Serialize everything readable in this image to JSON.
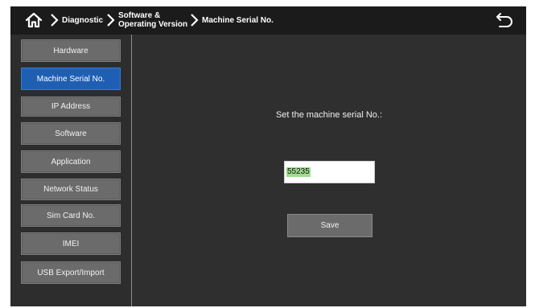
{
  "breadcrumb": {
    "items": [
      "Diagnostic",
      "Software & Operating Version",
      "Machine Serial No."
    ],
    "item2_line1": "Software &",
    "item2_line2": "Operating Version"
  },
  "icons": {
    "home": "home-icon",
    "chevron": "chevron-right-icon",
    "back": "back-arrow-icon"
  },
  "sidebar": {
    "items": [
      {
        "label": "Hardware",
        "active": false
      },
      {
        "label": "Machine Serial No.",
        "active": true
      },
      {
        "label": "IP Address",
        "active": false
      },
      {
        "label": "Software",
        "active": false
      },
      {
        "label": "Application",
        "active": false
      },
      {
        "label": "Network Status",
        "active": false
      },
      {
        "label": "Sim Card No.",
        "active": false
      },
      {
        "label": "IMEI",
        "active": false
      },
      {
        "label": "USB Export/Import",
        "active": false
      }
    ]
  },
  "main": {
    "prompt": "Set the machine serial No.:",
    "serial_value": "55235",
    "save_label": "Save"
  },
  "colors": {
    "active": "#1e5fb4",
    "button": "#6b6b6b",
    "topbar": "#1b1b1b",
    "background": "#303030",
    "selection_highlight": "#9fdc8f"
  }
}
